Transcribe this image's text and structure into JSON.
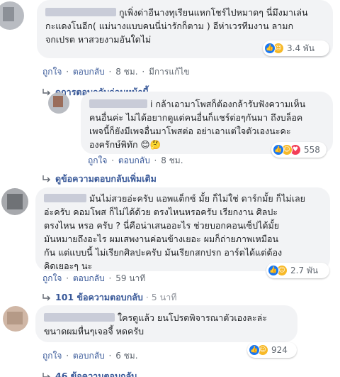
{
  "actions": {
    "like": "ถูกใจ",
    "reply": "ตอบกลับ",
    "edited": "มีการแก้ไข"
  },
  "comments": [
    {
      "lines": [
        "กูเพิ่งด่าอีนางทุเรียนแหกโชร์ไปหมาดๆ นี่มึงมาเล่น",
        "กะแดงโนอีก( แม่นางแบบคนนี่น่ารักก็ตาม ) อีห่าเวรทีมงาน ลามก",
        "จกเปรต หาสวยงามอันใดไม่"
      ],
      "time": "8 ชม.",
      "reactions": "3.4 พัน"
    },
    {
      "lines": [
        "i กล้าเอามาโพสก็ต้องกล้ารับฟังความเห็น",
        "คนอื่นค่ะ ไม่ได้อยากดูแต่คนอื่นก็แชร์ต่อๆกันมา ถึงบล็อค",
        "เพจนี้ก็ยังมีเพจอื่นมาโพสต่อ อย่าเอาแต่ใจตัวเองนะคะ",
        "องครักษ์พิทัก 😊🤔"
      ],
      "time": "8 ชม.",
      "reactions": "558"
    },
    {
      "lines": [
        "มันไม่สวยอ่ะครับ แอพแต็กซ์ มั้ย ก็ไม่ใช่ ดาร์กมั้ย ก็ไม่เลย",
        "อ่ะครับ คอมโพส ก็ไม่ได้ด้วย ตรงไหนหรอครับ เรียกงาน ศิลปะ",
        "ตรงไหน หรอ ครับ ? นี่คือน่าเสนออะไร ช่วยบอกคอนเซ็ปได้มั้ย",
        "มันหมายถึงอะไร ผมเสพงานค่อนข้างเยอะ ผมก็ถ่ายภาพเหมือน",
        "กัน แต่แบบนี้ ไม่เรียกศิลปะครับ มันเรียกสกปรก อาร์ตได้แต่ต้อง",
        "คิดเยอะๆ นะ"
      ],
      "time": "59 นาที",
      "reactions": "2.7 พัน"
    },
    {
      "lines": [
        "ใครดูแล้ว ยนโปรดพิจารณาตัวเองละล่ะ",
        "ขนาดผมหื่นๆเจอจี้ หดครับ"
      ],
      "time": "6 ชม.",
      "reactions": "924"
    }
  ],
  "links": {
    "previous_replies": "ดูการตอบกลับก่อนหน้านี้",
    "more_replies": "ดูข้อความตอบกลับเพิ่มเติม",
    "replies_101": "101 ข้อความตอบกลับ",
    "replies_101_time": "5 นาที",
    "replies_46": "46 ข้อความตอบกลับ"
  },
  "colors": {
    "link": "#385898",
    "bubble": "#f2f3f5",
    "like": "#1877f2",
    "haha": "#f7b928",
    "love": "#f33e58"
  },
  "icons": {
    "reply_arrow": "reply-arrow-icon",
    "like": "like-reaction-icon",
    "haha": "haha-reaction-icon",
    "love": "love-reaction-icon"
  }
}
